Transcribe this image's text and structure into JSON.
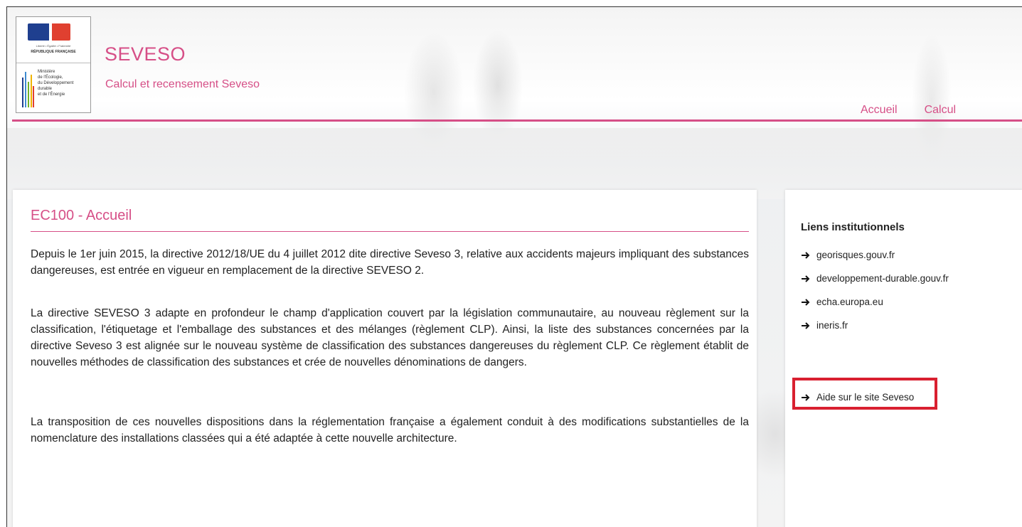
{
  "branding": {
    "motto": "Liberté • Égalité • Fraternité",
    "republic": "RÉPUBLIQUE FRANÇAISE",
    "ministry": "Ministère\nde l'Écologie,\ndu Développement\ndurable\net de l'Énergie",
    "site_title": "SEVESO",
    "site_subtitle": "Calcul et recensement Seveso"
  },
  "nav": {
    "items": [
      {
        "label": "Accueil"
      },
      {
        "label": "Calcul"
      }
    ]
  },
  "main": {
    "title": "EC100 - Accueil",
    "paragraphs": [
      "Depuis le 1er juin 2015, la directive 2012/18/UE du 4 juillet 2012 dite directive Seveso 3, relative aux accidents majeurs impliquant des substances dangereuses, est entrée en vigueur en remplacement de la directive SEVESO 2.",
      "La directive SEVESO 3 adapte en profondeur le champ d'application couvert par la législation communautaire, au nouveau règlement sur la classification, l'étiquetage et l'emballage des substances et des mélanges (règlement CLP). Ainsi, la liste des substances concernées par la directive Seveso 3 est alignée sur le nouveau système de classification des substances dangereuses du règlement CLP. Ce règlement établit de nouvelles méthodes de classification des substances et crée de nouvelles dénominations de dangers.",
      "La transposition de ces nouvelles dispositions dans la réglementation française a également conduit à des modifications substantielles de la nomenclature des installations classées qui a été adaptée à cette nouvelle architecture."
    ]
  },
  "sidebar": {
    "title": "Liens institutionnels",
    "links": [
      {
        "label": "georisques.gouv.fr"
      },
      {
        "label": "developpement-durable.gouv.fr"
      },
      {
        "label": "echa.europa.eu"
      },
      {
        "label": "ineris.fr"
      }
    ],
    "help_link": {
      "label": "Aide sur le site Seveso"
    }
  },
  "colors": {
    "brand_pink": "#d64f87",
    "highlight_red": "#d92030",
    "flag_blue": "#1f3f8f",
    "flag_red": "#e04030"
  }
}
